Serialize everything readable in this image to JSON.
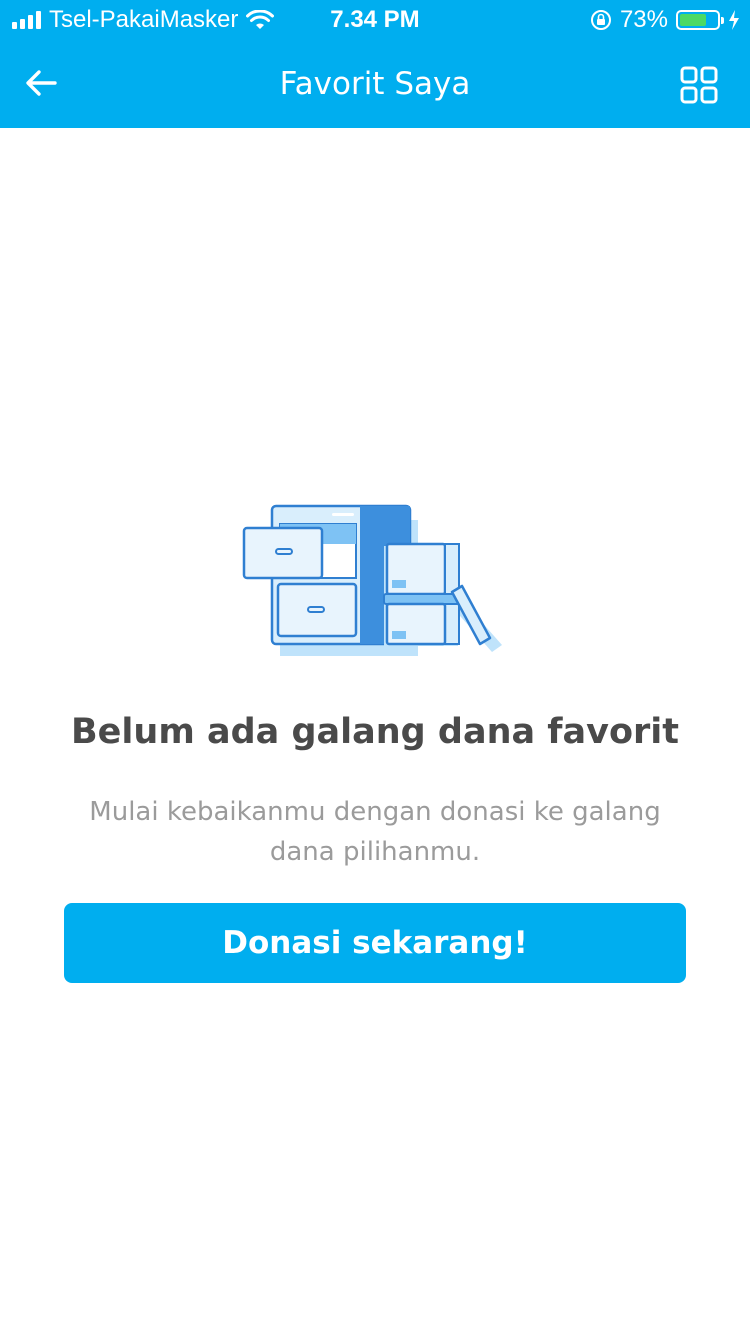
{
  "status_bar": {
    "carrier": "Tsel-PakaiMasker",
    "time": "7.34 PM",
    "battery_percent": "73%",
    "battery_level": 0.73,
    "battery_color": "#4cd964"
  },
  "header": {
    "title": "Favorit Saya",
    "back_icon": "arrow-left-icon",
    "grid_icon": "grid-view-icon",
    "background": "#00aeef"
  },
  "empty_state": {
    "illustration": "file-cabinet-illustration",
    "title": "Belum ada galang dana favorit",
    "subtitle": "Mulai kebaikanmu dengan donasi ke galang dana pilihanmu.",
    "button_label": "Donasi sekarang!"
  },
  "colors": {
    "brand": "#00aeef",
    "title_text": "#4a4a4a",
    "subtitle_text": "#9b9b9b"
  }
}
